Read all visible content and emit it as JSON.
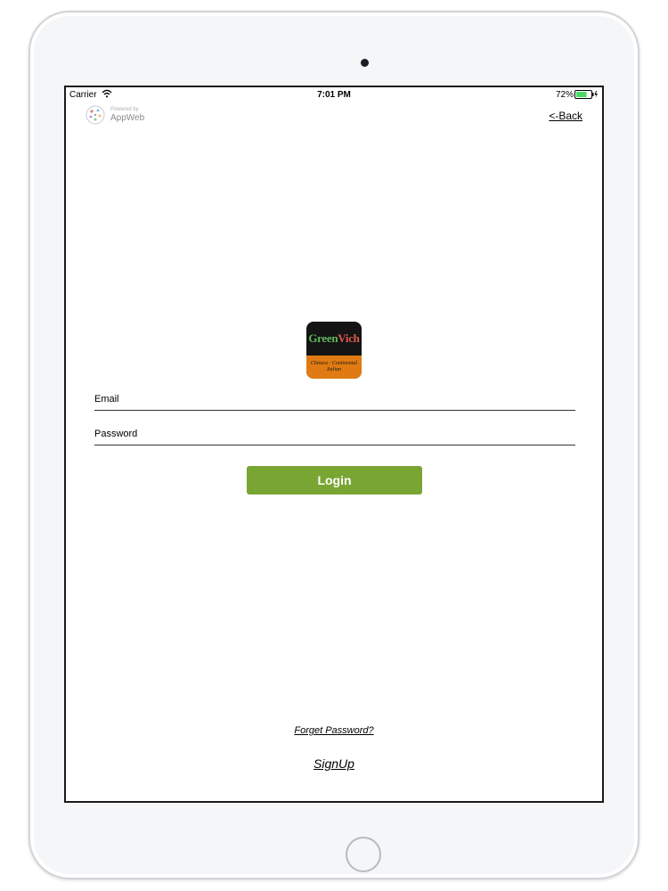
{
  "status_bar": {
    "carrier": "Carrier",
    "time": "7:01 PM",
    "battery": "72%",
    "battery_level": 0.72
  },
  "header": {
    "powered_by": "Powered by",
    "appweb": "AppWeb",
    "back_label": "<-Back"
  },
  "brand": {
    "name_part1": "Green",
    "name_part2": "Vich",
    "tagline_line1": "Chinese · Continental",
    "tagline_line2": "Italian"
  },
  "form": {
    "email_placeholder": "Email",
    "password_placeholder": "Password",
    "login_label": "Login"
  },
  "links": {
    "forget_password": "Forget Password?",
    "signup": "SignUp"
  },
  "colors": {
    "login_button": "#79a533",
    "brand_bottom": "#e07a12",
    "battery_fill": "#4cd964"
  }
}
